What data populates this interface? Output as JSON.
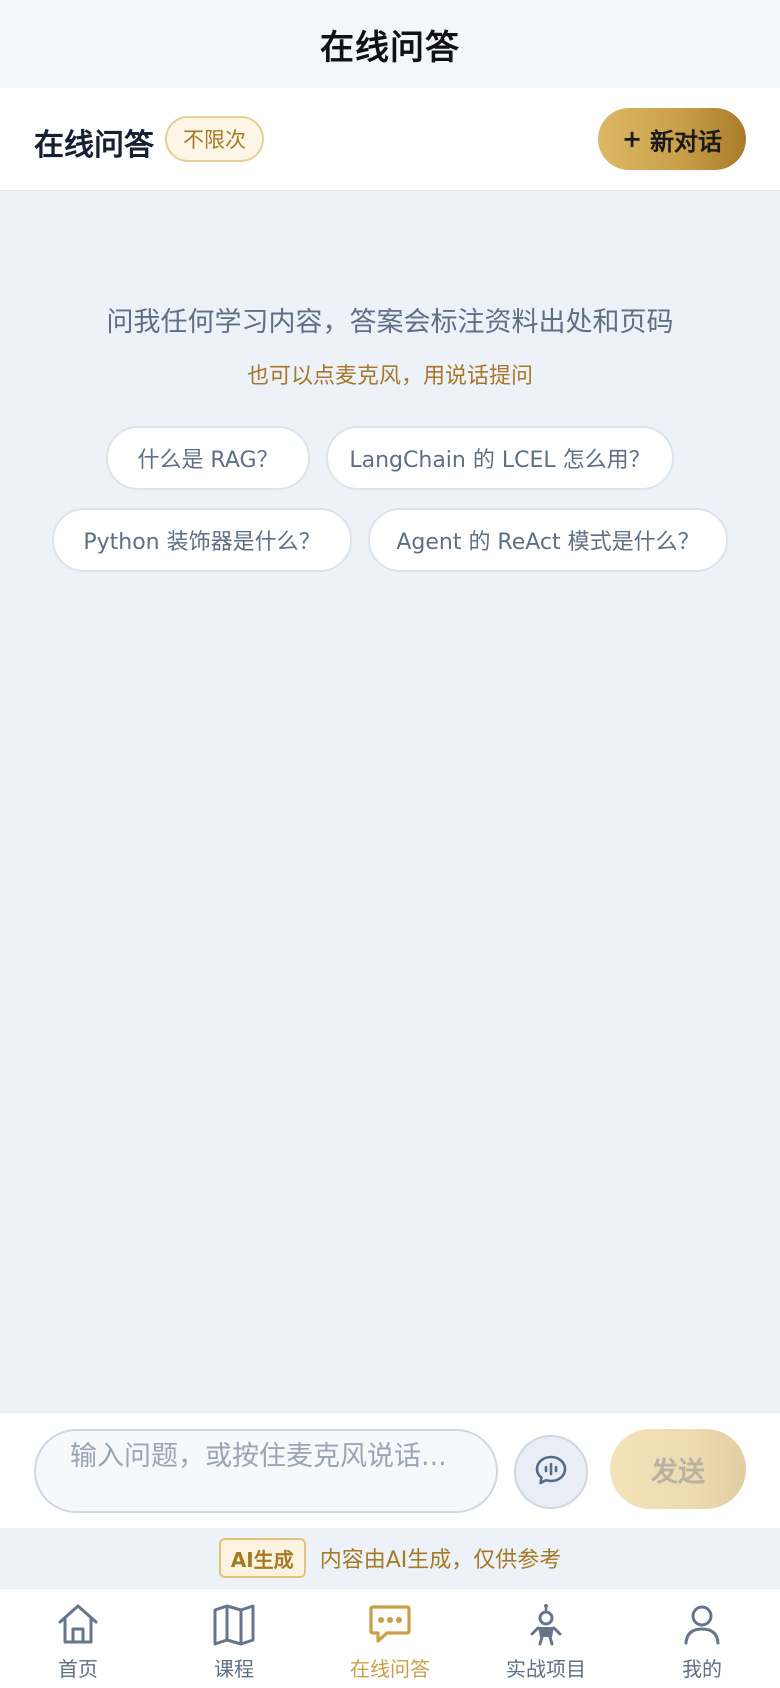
{
  "nav_bar": {
    "title": "在线问答"
  },
  "header": {
    "title": "在线问答",
    "badge": "不限次",
    "new_chat_icon": "+",
    "new_chat_label": "新对话"
  },
  "hero": {
    "line1": "问我任何学习内容，答案会标注资料出处和页码",
    "line2": "也可以点麦克风，用说话提问"
  },
  "suggestions": [
    "什么是 RAG？",
    "LangChain 的 LCEL 怎么用？",
    "Python 装饰器是什么？",
    "Agent 的 ReAct 模式是什么？"
  ],
  "composer": {
    "placeholder": "输入问题，或按住麦克风说话...",
    "mic_icon": "voice-chat-icon",
    "send_label": "发送"
  },
  "disclaimer": {
    "tag": "AI生成",
    "text": "内容由AI生成，仅供参考"
  },
  "tabbar": {
    "items": [
      {
        "label": "首页",
        "icon": "home-icon",
        "active": false
      },
      {
        "label": "课程",
        "icon": "book-icon",
        "active": false
      },
      {
        "label": "在线问答",
        "icon": "chat-icon",
        "active": true
      },
      {
        "label": "实战项目",
        "icon": "robot-icon",
        "active": false
      },
      {
        "label": "我的",
        "icon": "user-icon",
        "active": false
      }
    ]
  },
  "colors": {
    "accent": "#c9a048",
    "background": "#edf2f9",
    "text_muted": "#5f6f86"
  }
}
